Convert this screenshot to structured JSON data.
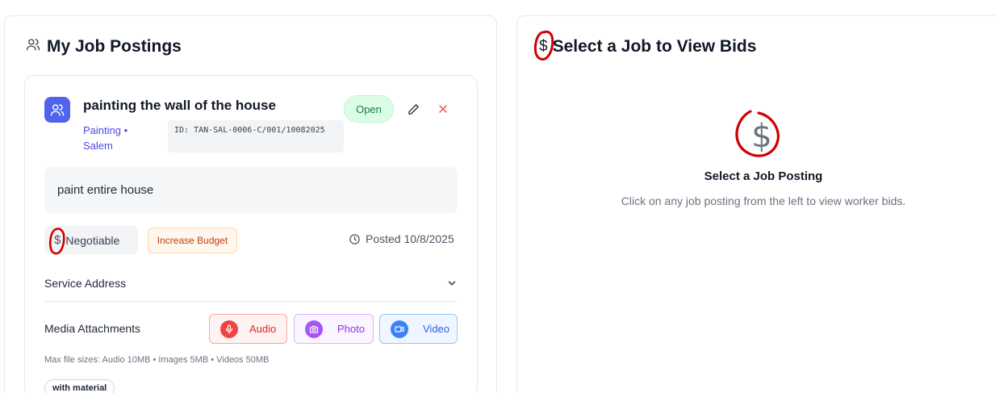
{
  "left_panel": {
    "title": "My Job Postings",
    "title_icon": "users-icon"
  },
  "job": {
    "title": "painting the wall of the house",
    "category_location": "Painting • Salem",
    "id_text": "ID: TAN-SAL-0006-C/001/10082025",
    "status": "Open",
    "description": "paint entire house",
    "budget": "Negotiable",
    "increase_budget_label": "Increase Budget",
    "posted": "Posted 10/8/2025",
    "service_address_label": "Service Address",
    "media_label": "Media Attachments",
    "media_buttons": {
      "audio": "Audio",
      "photo": "Photo",
      "video": "Video"
    },
    "file_limits": "Max file sizes: Audio 10MB • Images 5MB • Videos 50MB",
    "tag": "with material"
  },
  "right_panel": {
    "title": "Select a Job to View Bids",
    "empty_title": "Select a Job Posting",
    "empty_subtitle": "Click on any job posting from the left to view worker bids."
  },
  "colors": {
    "accent": "#4f63ec",
    "open_badge": "#dcfce7",
    "annotation": "#d00000"
  }
}
